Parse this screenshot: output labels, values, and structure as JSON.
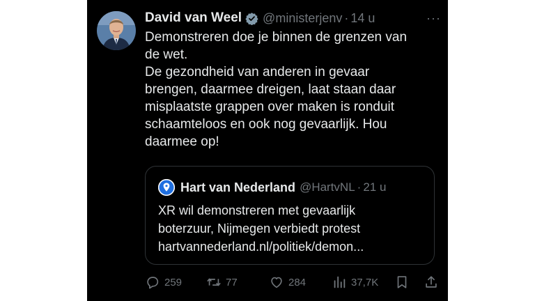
{
  "tweet": {
    "author_name": "David van Weel",
    "handle": "@ministerjenv",
    "separator": "·",
    "time": "14 u",
    "more": "···",
    "text": "Demonstreren doe je binnen de grenzen van\nde wet.\nDe gezondheid van anderen in gevaar\nbrengen, daarmee dreigen, laat staan daar\nmisplaatste grappen over maken is ronduit\nschaamteloos en ook nog gevaarlijk. Hou\ndaarmee op!",
    "verified_icon": "verified-badge-icon",
    "colors": {
      "background": "#000000",
      "text": "#e7e9ea",
      "muted": "#71767b",
      "verified": "#829aab"
    }
  },
  "quote": {
    "author_name": "Hart van Nederland",
    "handle": "@HartvNL",
    "separator": "·",
    "time": "21 u",
    "text": "XR wil demonstreren met gevaarlijk\nboterzuur, Nijmegen verbiedt protest\nhartvannederland.nl/politiek/demon...",
    "avatar_icon": "pin-logo-icon"
  },
  "actions": {
    "replies": "259",
    "reposts": "77",
    "likes": "284",
    "views": "37,7K",
    "icons": [
      "reply-icon",
      "repost-icon",
      "like-icon",
      "views-icon",
      "bookmark-icon",
      "share-icon"
    ]
  }
}
